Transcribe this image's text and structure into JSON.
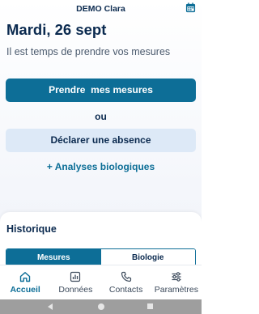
{
  "header": {
    "title": "DEMO Clara",
    "calendar_icon": "calendar-icon"
  },
  "main": {
    "date": "Mardi, 26 sept",
    "subtitle": "Il est temps de prendre vos mesures",
    "primary_button": "Prendre  mes mesures",
    "separator": "ou",
    "secondary_button": "Déclarer une absence",
    "link": "+ Analyses biologiques"
  },
  "history": {
    "title": "Historique",
    "tabs": [
      {
        "label": "Mesures",
        "active": true
      },
      {
        "label": "Biologie",
        "active": false
      }
    ]
  },
  "bottom_nav": {
    "items": [
      {
        "label": "Accueil",
        "icon": "home-icon",
        "active": true
      },
      {
        "label": "Données",
        "icon": "chart-icon",
        "active": false
      },
      {
        "label": "Contacts",
        "icon": "phone-icon",
        "active": false
      },
      {
        "label": "Paramètres",
        "icon": "sliders-icon",
        "active": false
      }
    ]
  },
  "colors": {
    "primary": "#0d6e97",
    "navy": "#0b2a4f",
    "secondary_bg": "#dde9f7"
  }
}
